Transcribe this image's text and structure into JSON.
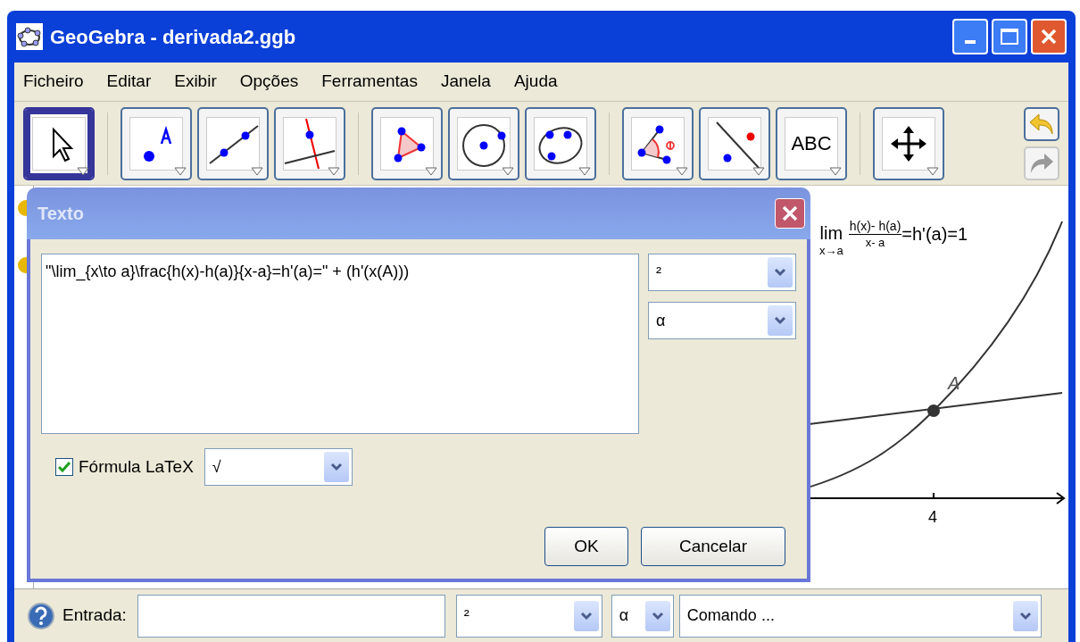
{
  "window": {
    "title": "GeoGebra - derivada2.ggb"
  },
  "menu": [
    "Ficheiro",
    "Editar",
    "Exibir",
    "Opções",
    "Ferramentas",
    "Janela",
    "Ajuda"
  ],
  "toolbar": {
    "tools": [
      {
        "kind": "move",
        "selected": true
      },
      {
        "kind": "point",
        "selected": false
      },
      {
        "kind": "line",
        "selected": false
      },
      {
        "kind": "perpendicular",
        "selected": false
      },
      {
        "kind": "polygon",
        "selected": false
      },
      {
        "kind": "circle",
        "selected": false
      },
      {
        "kind": "conic",
        "selected": false
      },
      {
        "kind": "angle",
        "selected": false
      },
      {
        "kind": "reflect",
        "selected": false
      },
      {
        "kind": "text",
        "label": "ABC",
        "selected": false
      },
      {
        "kind": "pan",
        "selected": false
      }
    ]
  },
  "dialog": {
    "title": "Texto",
    "text": "\"\\lim_{x\\to a}\\frac{h(x)-h(a)}{x-a}=h'(a)=\" + (h'(x(A)))",
    "symbol_menus": [
      "²",
      "α"
    ],
    "latex": {
      "label": "Fórmula LaTeX",
      "checked": true
    },
    "latex_menu": "√",
    "buttons": [
      "OK",
      "Cancelar"
    ]
  },
  "graphics": {
    "formula": {
      "lim": "lim",
      "subscript": "x→a",
      "numerator": "h(x)- h(a)",
      "denominator": "x- a",
      "result": "=h'(a)=1"
    },
    "point_label": "A",
    "x_tick": "4"
  },
  "input_bar": {
    "label": "Entrada:",
    "symbol_menus": [
      "²",
      "α"
    ],
    "command_menu": "Comando ..."
  }
}
